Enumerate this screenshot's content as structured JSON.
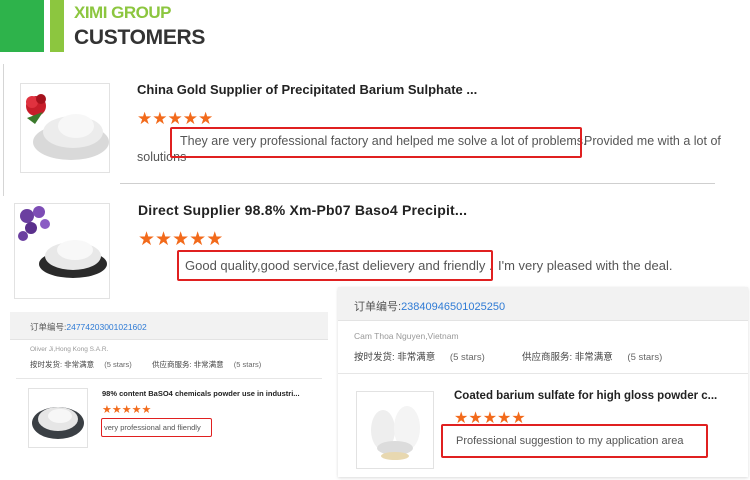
{
  "header": {
    "brand": "XIMI GROUP",
    "title": "CUSTOMERS"
  },
  "colors": {
    "green": "#2eb34b",
    "lime": "#8cc63f",
    "star": "#f26a1b",
    "highlight": "#e02020",
    "order_link": "#2f7bd5"
  },
  "reviews": [
    {
      "product": "China Gold Supplier of Precipitated Barium Sulphate ...",
      "stars": 5,
      "star_glyph": "★",
      "highlight": "They are very professional factory and helped me solve a lot of problems.",
      "rest_line1": "Provided me with a lot of",
      "rest_line2": "solutions"
    },
    {
      "product": "Direct Supplier 98.8% Xm-Pb07 Baso4 Precipit...",
      "stars": 5,
      "star_glyph": "★",
      "highlight": "Good quality,good service,fast delievery and friendly .",
      "rest": "I'm very pleased with the deal."
    }
  ],
  "orders": [
    {
      "order_label": "订单编号:",
      "order_number": "24774203001021602",
      "customer": "Oliver Ji,Hong Kong S.A.R.",
      "ship_label": "按时发货: 非常满意",
      "ship_stars": "(5 stars)",
      "service_label": "供应商服务: 非常满意",
      "service_stars": "(5 stars)",
      "product": "98% content BaSO4 chemicals powder use in industri...",
      "stars": 5,
      "star_glyph": "★",
      "review": "very professional and fliendly"
    },
    {
      "order_label": "订单编号:",
      "order_number": "23840946501025250",
      "customer": "Cam Thoa Nguyen,Vietnam",
      "ship_label": "按时发货: 非常满意",
      "ship_stars": "(5 stars)",
      "service_label": "供应商服务: 非常满意",
      "service_stars": "(5 stars)",
      "product": "Coated barium sulfate for high gloss powder c...",
      "stars": 5,
      "star_glyph": "★",
      "review": "Professional suggestion to my application area"
    }
  ]
}
